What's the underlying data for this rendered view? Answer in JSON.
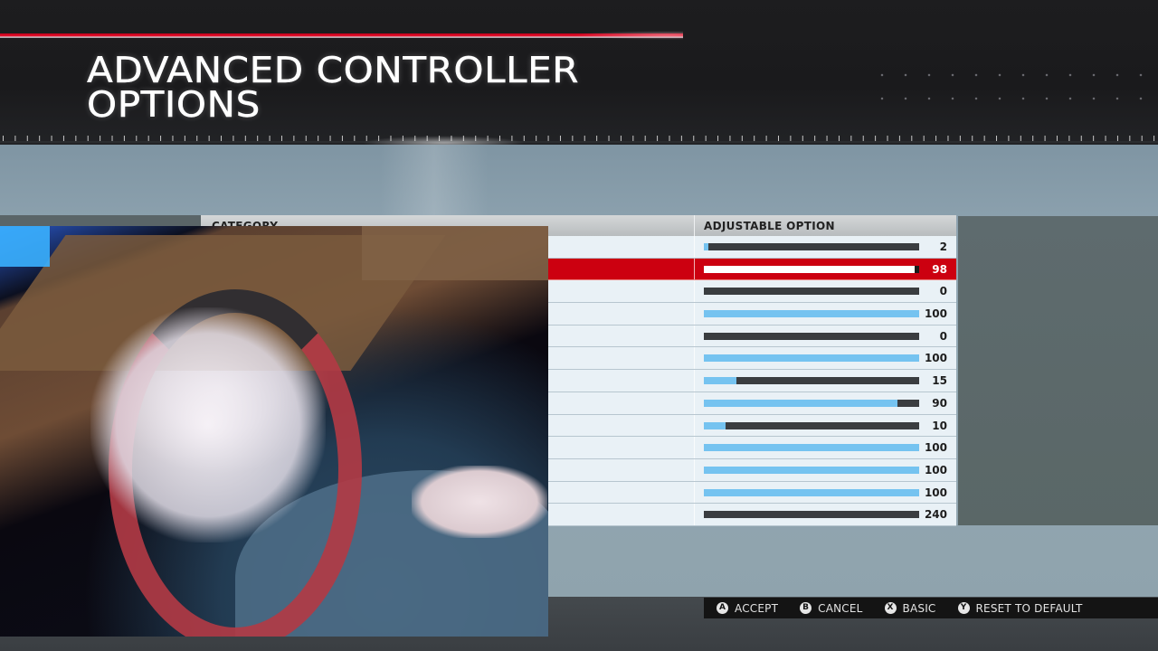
{
  "header": {
    "title_line1": "ADVANCED CONTROLLER",
    "title_line2": "OPTIONS"
  },
  "table": {
    "category_header": "CATEGORY",
    "option_header": "ADJUSTABLE OPTION",
    "selected_index": 1,
    "rows": [
      {
        "label": "",
        "value": "2",
        "fill_percent": 2
      },
      {
        "label": "",
        "value": "98",
        "fill_percent": 98
      },
      {
        "label": "",
        "value": "0",
        "fill_percent": 0
      },
      {
        "label": "",
        "value": "100",
        "fill_percent": 100
      },
      {
        "label": "",
        "value": "0",
        "fill_percent": 0
      },
      {
        "label": "",
        "value": "100",
        "fill_percent": 100
      },
      {
        "label": "",
        "value": "15",
        "fill_percent": 15
      },
      {
        "label": "",
        "value": "90",
        "fill_percent": 90
      },
      {
        "label": "",
        "value": "10",
        "fill_percent": 10
      },
      {
        "label": "",
        "value": "100",
        "fill_percent": 100
      },
      {
        "label": "",
        "value": "100",
        "fill_percent": 100
      },
      {
        "label": "",
        "value": "100",
        "fill_percent": 100
      },
      {
        "label": "",
        "value": "240",
        "fill_percent": 0
      }
    ]
  },
  "footer": {
    "buttons": [
      {
        "glyph": "A",
        "label": "ACCEPT"
      },
      {
        "glyph": "B",
        "label": "CANCEL"
      },
      {
        "glyph": "X",
        "label": "BASIC"
      },
      {
        "glyph": "Y",
        "label": "RESET TO DEFAULT"
      }
    ]
  },
  "colors": {
    "accent_red": "#cc0010",
    "bar_fill": "#75c3f0",
    "bar_track": "#3a3d40"
  }
}
